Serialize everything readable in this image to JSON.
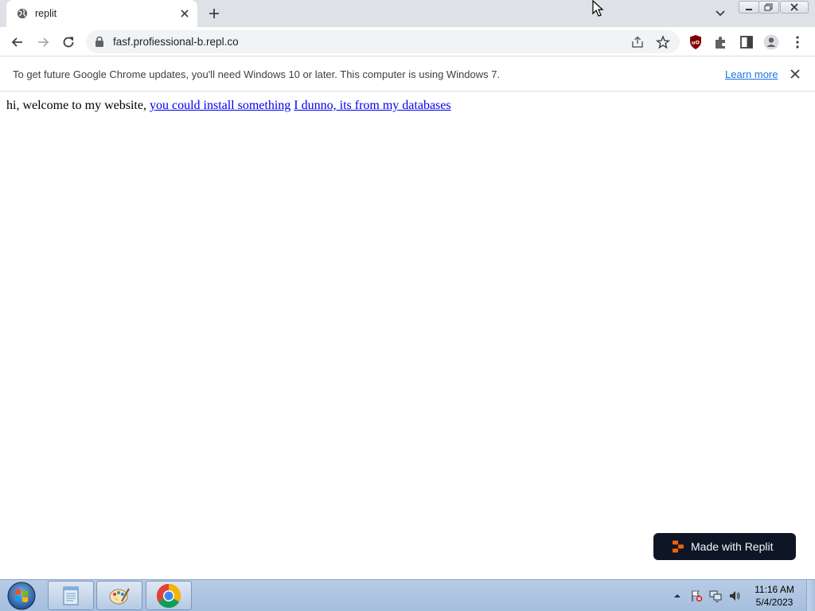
{
  "browser": {
    "tab": {
      "title": "replit"
    },
    "address_bar": {
      "url": "fasf.profiessional-b.repl.co"
    }
  },
  "infobar": {
    "message": "To get future Google Chrome updates, you'll need Windows 10 or later. This computer is using Windows 7.",
    "learn_more": "Learn more"
  },
  "page": {
    "intro_text": "hi, welcome to my website, ",
    "link_1": "you could install something",
    "link_2": "I dunno, its from my databases",
    "badge_label": "Made with Replit"
  },
  "taskbar": {
    "clock_time": "11:16 AM",
    "clock_date": "5/4/2023",
    "apps": [
      "notepad-icon",
      "paint-icon",
      "chrome-icon"
    ]
  },
  "colors": {
    "link": "#0000ee",
    "replit_orange": "#f26207",
    "badge_bg": "#0e1525",
    "chrome_accent": "#1a73e8"
  }
}
